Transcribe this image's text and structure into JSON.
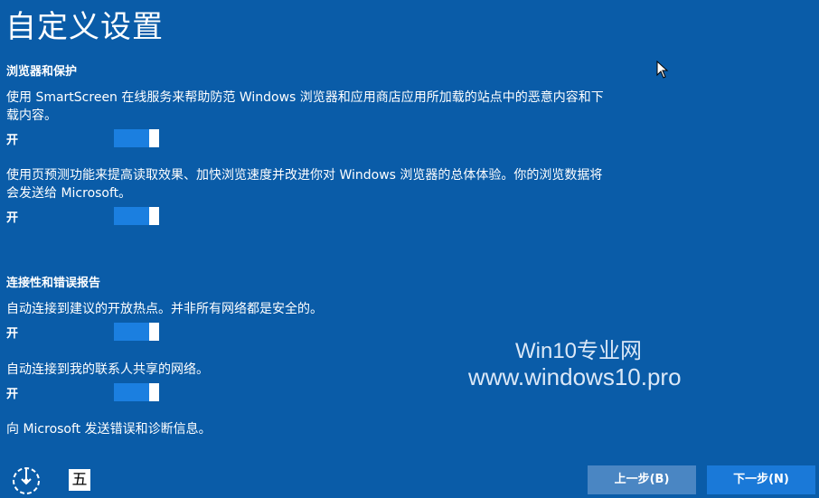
{
  "page": {
    "title": "自定义设置"
  },
  "sections": {
    "browser": {
      "heading": "浏览器和保护",
      "item1_desc": "使用 SmartScreen 在线服务来帮助防范 Windows 浏览器和应用商店应用所加载的站点中的恶意内容和下载内容。",
      "item1_state": "开",
      "item2_desc": "使用页预测功能来提高读取效果、加快浏览速度并改进你对 Windows 浏览器的总体体验。你的浏览数据将会发送给 Microsoft。",
      "item2_state": "开"
    },
    "connectivity": {
      "heading": "连接性和错误报告",
      "item1_desc": "自动连接到建议的开放热点。并非所有网络都是安全的。",
      "item1_state": "开",
      "item2_desc": "自动连接到我的联系人共享的网络。",
      "item2_state": "开",
      "item3_desc": "向 Microsoft 发送错误和诊断信息。"
    }
  },
  "watermark": {
    "line1": "Win10专业网",
    "line2": "www.windows10.pro"
  },
  "bottom": {
    "ime_label": "五",
    "prev_label": "上一步(B)",
    "next_label": "下一步(N)"
  },
  "colors": {
    "background": "#0a5ca8",
    "toggle_on": "#1b7fe0",
    "prev_button": "#4a86c3",
    "next_button": "#1a79d8"
  },
  "icons": {
    "ease_of_access": "ease-of-access-icon",
    "ime": "ime-icon",
    "cursor": "mouse-pointer-icon"
  }
}
